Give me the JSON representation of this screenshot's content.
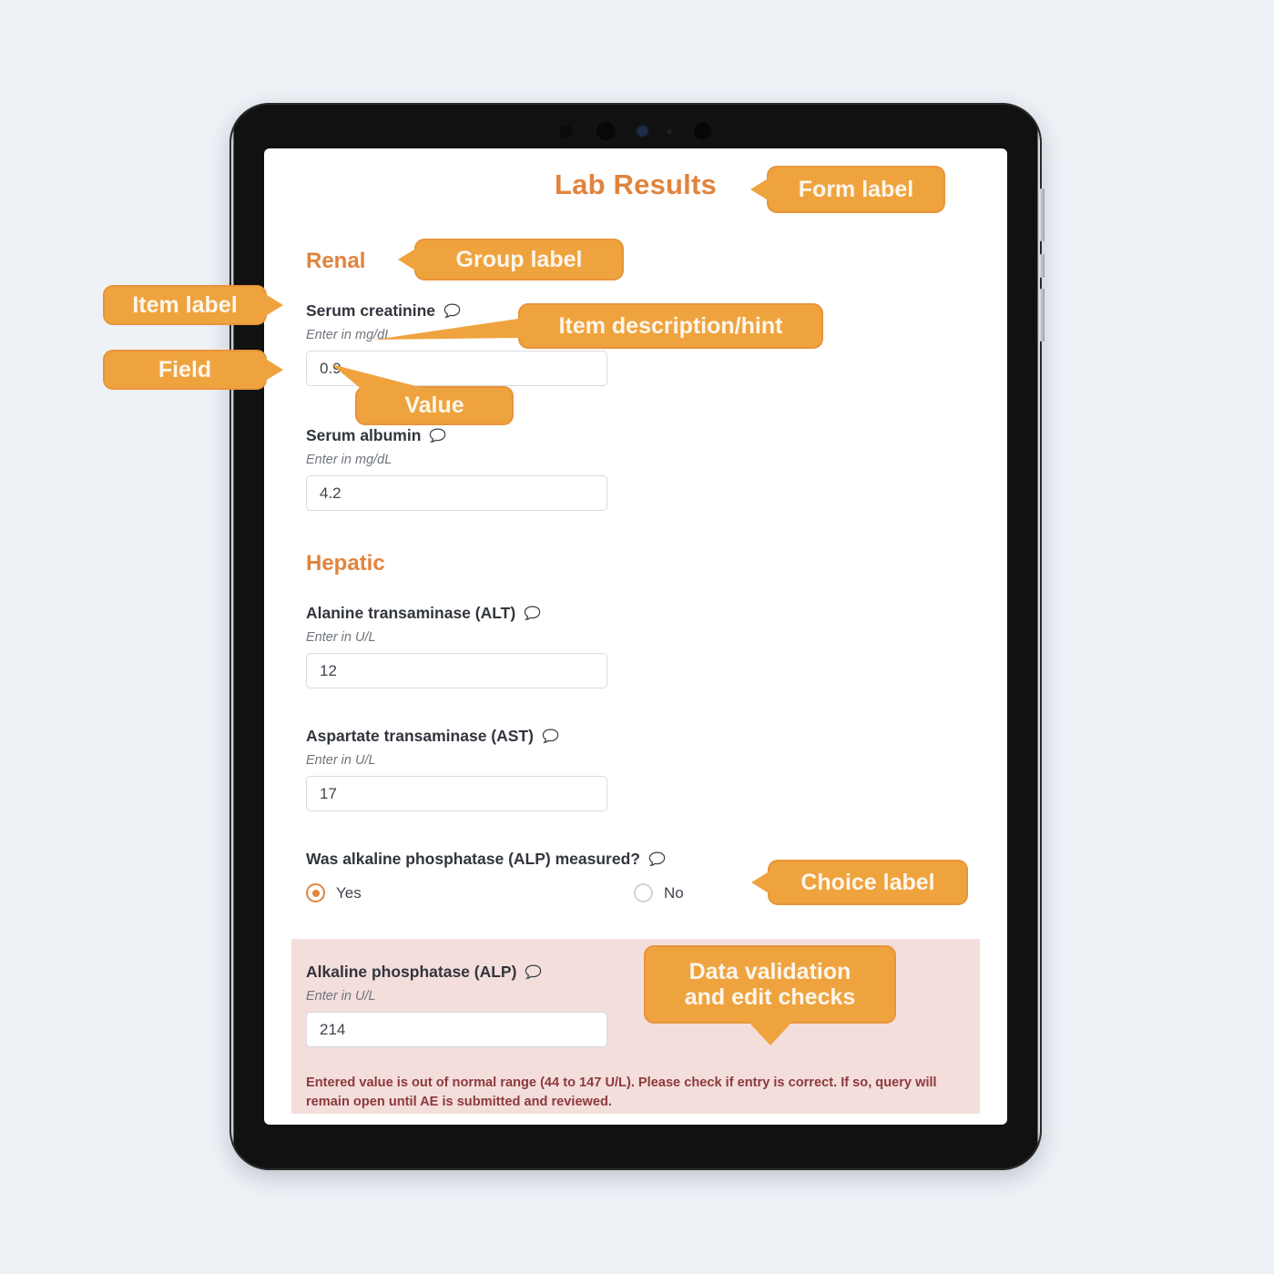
{
  "device": {
    "name": "tablet-device",
    "camera_icons": [
      "sensor-dot",
      "camera-lens",
      "flash-sensor",
      "mic-dot",
      "camera-lens"
    ],
    "side_buttons": [
      "volume-up-button",
      "volume-down-button",
      "power-button"
    ]
  },
  "form": {
    "title": "Lab Results",
    "groups": [
      {
        "label": "Renal",
        "items": [
          {
            "label": "Serum creatinine",
            "icon": "comment-bubble-icon",
            "hint": "Enter in mg/dL",
            "value": "0.9",
            "type": "text"
          },
          {
            "label": "Serum albumin",
            "icon": "comment-bubble-icon",
            "hint": "Enter in mg/dL",
            "value": "4.2",
            "type": "text"
          }
        ]
      },
      {
        "label": "Hepatic",
        "items": [
          {
            "label": "Alanine transaminase (ALT)",
            "icon": "comment-bubble-icon",
            "hint": "Enter in U/L",
            "value": "12",
            "type": "text"
          },
          {
            "label": "Aspartate transaminase (AST)",
            "icon": "comment-bubble-icon",
            "hint": "Enter in U/L",
            "value": "17",
            "type": "text"
          },
          {
            "label": "Was alkaline phosphatase (ALP) measured?",
            "icon": "comment-bubble-icon",
            "type": "radio",
            "options": [
              {
                "label": "Yes",
                "selected": true
              },
              {
                "label": "No",
                "selected": false
              }
            ]
          },
          {
            "label": "Alkaline phosphatase (ALP)",
            "icon": "comment-bubble-icon",
            "hint": "Enter in U/L",
            "value": "214",
            "type": "text",
            "validation": {
              "state": "error",
              "message": "Entered value is out of normal range (44 to 147 U/L). Please check if entry is correct. If so, query will remain open until AE is submitted and reviewed."
            }
          }
        ]
      }
    ]
  },
  "annotations": {
    "form_label": "Form label",
    "group_label": "Group label",
    "item_label": "Item label",
    "item_hint": "Item description/hint",
    "field": "Field",
    "value": "Value",
    "choice_label": "Choice label",
    "validation": "Data validation\nand edit checks"
  },
  "colors": {
    "accent_orange": "#e2833d",
    "callout_orange": "#efa33e",
    "callout_border": "#e8943a",
    "error_bg": "#f4dedc",
    "error_text": "#8c3a3c",
    "page_bg": "#eef2f7",
    "field_border": "#d8dade",
    "label_text": "#31353d",
    "hint_text": "#6f747c"
  }
}
